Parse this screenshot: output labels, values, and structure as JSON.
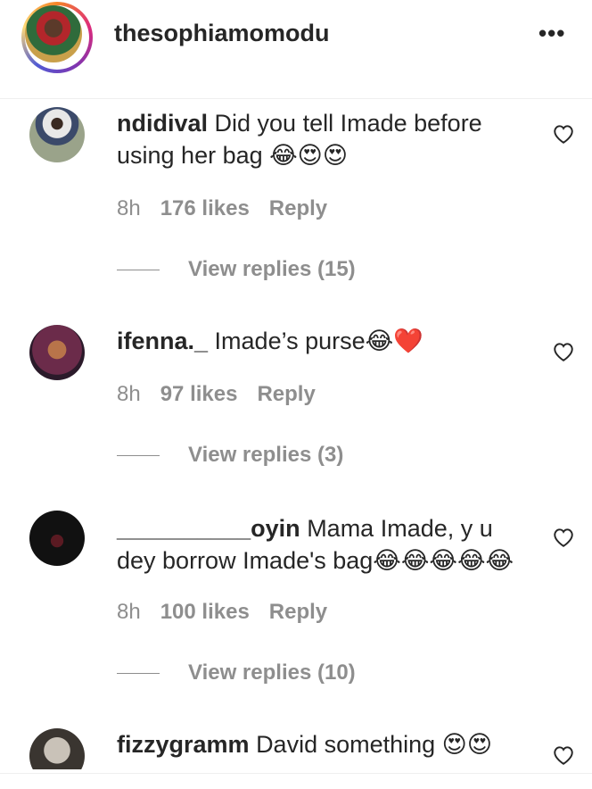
{
  "post": {
    "owner": "thesophiamomodu",
    "more": "•••"
  },
  "comments": [
    {
      "user": "ndidival",
      "text": "Did you tell Imade before using her bag 😂😍😍",
      "time": "8h",
      "likes": "176 likes",
      "reply": "Reply",
      "view_replies": "View replies (15)"
    },
    {
      "user": "ifenna._",
      "text": "Imade’s purse😂❤️",
      "time": "8h",
      "likes": "97 likes",
      "reply": "Reply",
      "view_replies": "View replies (3)"
    },
    {
      "user": "__________oyin",
      "text": "Mama Imade, y u dey borrow Imade's bag😂😂😂😂😂",
      "time": "8h",
      "likes": "100 likes",
      "reply": "Reply",
      "view_replies": "View replies (10)"
    },
    {
      "user": "fizzygramm",
      "text": "David something 😍😍",
      "time": "",
      "likes": "",
      "reply": "",
      "view_replies": ""
    }
  ],
  "colors": {
    "text": "#262626",
    "secondary": "#8e8e8e",
    "divider": "#efefef"
  },
  "icons": {
    "heart": "heart-icon",
    "more": "more-options-icon"
  }
}
